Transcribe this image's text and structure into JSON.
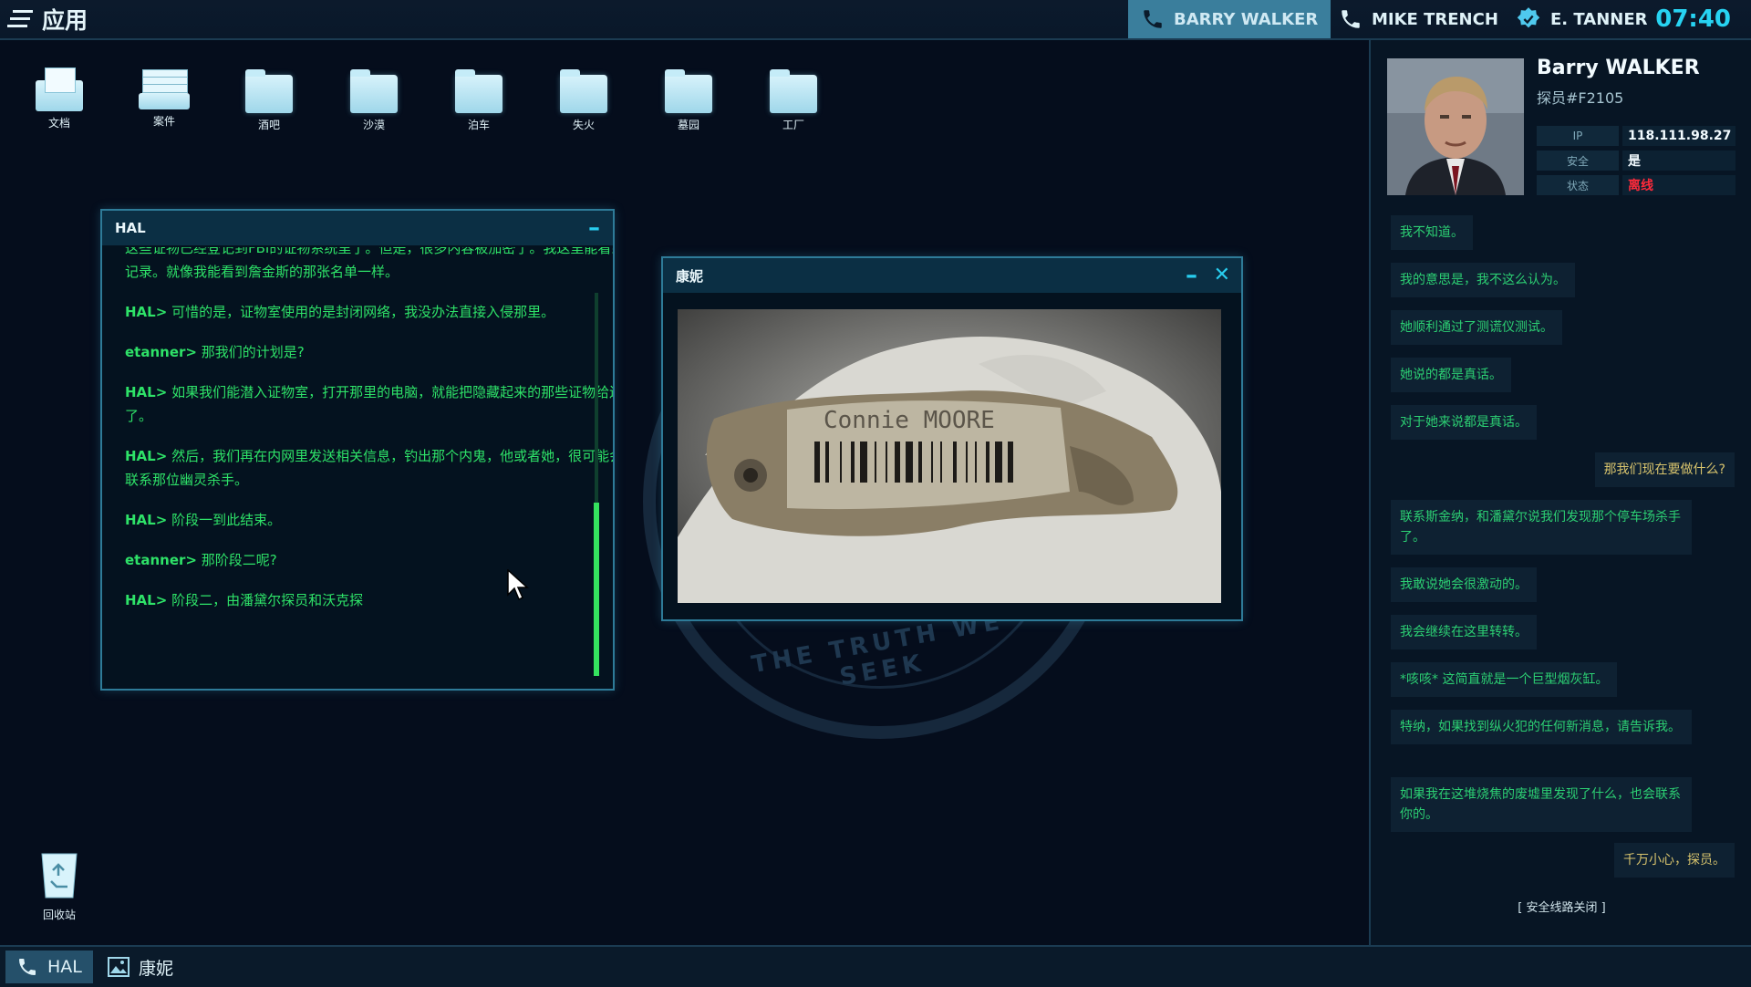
{
  "topbar": {
    "app_menu_label": "应用",
    "tabs": [
      {
        "label": "BARRY WALKER",
        "icon": "phone-icon"
      },
      {
        "label": "MIKE TRENCH",
        "icon": "phone-icon"
      },
      {
        "label": "E. TANNER",
        "icon": "badge-icon"
      }
    ],
    "clock": "07:40"
  },
  "desktop": {
    "icons": [
      {
        "label": "文档",
        "icon": "documents-folder-icon"
      },
      {
        "label": "案件",
        "icon": "case-tray-icon"
      },
      {
        "label": "酒吧",
        "icon": "folder-icon"
      },
      {
        "label": "沙漠",
        "icon": "folder-icon"
      },
      {
        "label": "泊车",
        "icon": "folder-icon"
      },
      {
        "label": "失火",
        "icon": "folder-icon"
      },
      {
        "label": "墓园",
        "icon": "folder-icon"
      },
      {
        "label": "工厂",
        "icon": "folder-icon"
      }
    ],
    "recycle_label": "回收站",
    "emblem_motto": "THE TRUTH WE SEEK"
  },
  "hal_window": {
    "title": "HAL",
    "lines": [
      {
        "speaker": "",
        "text": "这些证物已经登记到FBI的证物系统里了。但是，很多内容被加密了。我这里能看到操作记录。就像我能看到詹金斯的那张名单一样。"
      },
      {
        "speaker": "HAL>",
        "text": "可惜的是，证物室使用的是封闭网络，我没办法直接入侵那里。"
      },
      {
        "speaker": "etanner>",
        "text": "那我们的计划是?"
      },
      {
        "speaker": "HAL>",
        "text": "如果我们能潜入证物室，打开那里的电脑，就能把隐藏起来的那些证物给还原了。"
      },
      {
        "speaker": "HAL>",
        "text": "然后，我们再在内网里发送相关信息，钓出那个内鬼，他或者她，很可能会试着联系那位幽灵杀手。"
      },
      {
        "speaker": "HAL>",
        "text": "阶段一到此结束。"
      },
      {
        "speaker": "etanner>",
        "text": "那阶段二呢?"
      },
      {
        "speaker": "HAL>",
        "text": "阶段二，由潘黛尔探员和沃克探"
      }
    ]
  },
  "photo_window": {
    "title": "康妮",
    "photo_caption_text": "Connie MOORE"
  },
  "contact": {
    "name": "Barry WALKER",
    "agent_id": "探员#F2105",
    "fields": [
      {
        "key": "IP",
        "value": "118.111.98.27",
        "color": "#f2fbff"
      },
      {
        "key": "安全",
        "value": "是",
        "color": "#f2fbff"
      },
      {
        "key": "状态",
        "value": "离线",
        "color": "#ff2a3a"
      }
    ],
    "messages": [
      {
        "text": "我不知道。",
        "dir": "in"
      },
      {
        "text": "我的意思是，我不这么认为。",
        "dir": "in"
      },
      {
        "text": "她顺利通过了测谎仪测试。",
        "dir": "in"
      },
      {
        "text": "她说的都是真话。",
        "dir": "in"
      },
      {
        "text": "对于她来说都是真话。",
        "dir": "in"
      },
      {
        "text": "那我们现在要做什么?",
        "dir": "out"
      },
      {
        "text": "联系斯金纳，和潘黛尔说我们发现那个停车场杀手了。",
        "dir": "in"
      },
      {
        "text": "我敢说她会很激动的。",
        "dir": "in"
      },
      {
        "text": "我会继续在这里转转。",
        "dir": "in"
      },
      {
        "text": "*咳咳* 这简直就是一个巨型烟灰缸。",
        "dir": "in"
      },
      {
        "text": "特纳，如果找到纵火犯的任何新消息，请告诉我。",
        "dir": "in"
      },
      {
        "text": "如果我在这堆烧焦的废墟里发现了什么，也会联系你的。",
        "dir": "in"
      },
      {
        "text": "千万小心，探员。",
        "dir": "out"
      }
    ],
    "secure_closed": "[   安全线路关闭   ]"
  },
  "taskbar": {
    "items": [
      {
        "label": "HAL",
        "icon": "phone-icon"
      },
      {
        "label": "康妮",
        "icon": "image-icon"
      }
    ]
  },
  "colors": {
    "accent": "#28cdef",
    "terminal_green": "#2ee268",
    "offline_red": "#ff2a3a",
    "outgoing_msg": "#d8c46d"
  }
}
